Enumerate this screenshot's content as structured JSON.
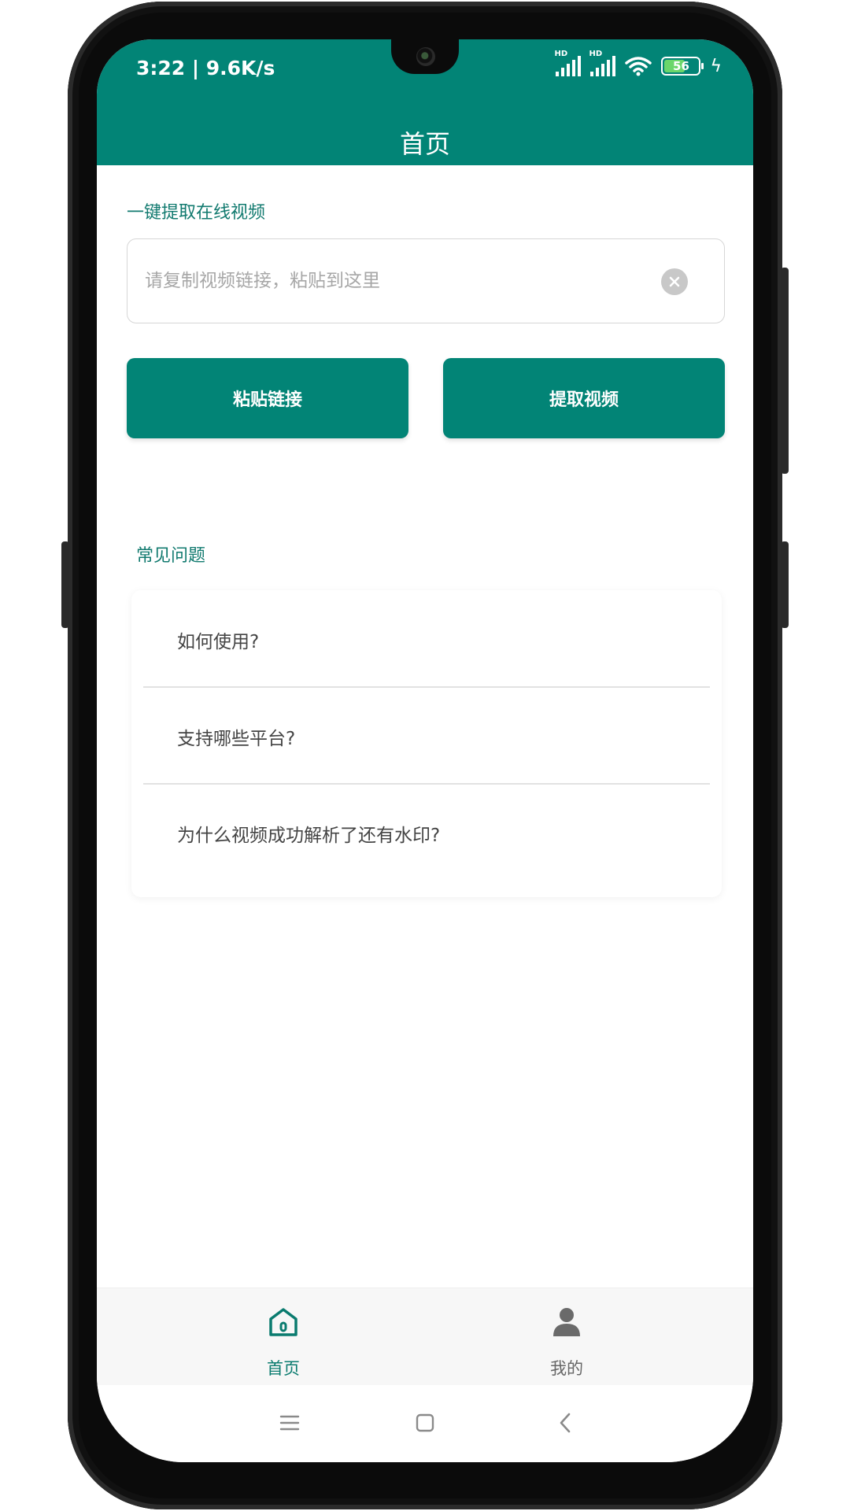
{
  "status_bar": {
    "time_speed": "3:22 | 9.6K/s",
    "signal_label": "HD",
    "battery_level": "56"
  },
  "header": {
    "title": "首页"
  },
  "extract": {
    "section_title": "一键提取在线视频",
    "input_placeholder": "请复制视频链接，粘贴到这里",
    "input_value": "",
    "paste_button": "粘贴链接",
    "extract_button": "提取视频"
  },
  "faq": {
    "section_title": "常见问题",
    "items": [
      {
        "label": "如何使用?"
      },
      {
        "label": "支持哪些平台?"
      },
      {
        "label": "为什么视频成功解析了还有水印?"
      }
    ]
  },
  "bottom_nav": {
    "tabs": [
      {
        "label": "首页",
        "icon": "home-icon",
        "active": true
      },
      {
        "label": "我的",
        "icon": "person-icon",
        "active": false
      }
    ]
  },
  "colors": {
    "accent": "#028476",
    "accent_text": "#117a6f",
    "inactive": "#666666"
  }
}
